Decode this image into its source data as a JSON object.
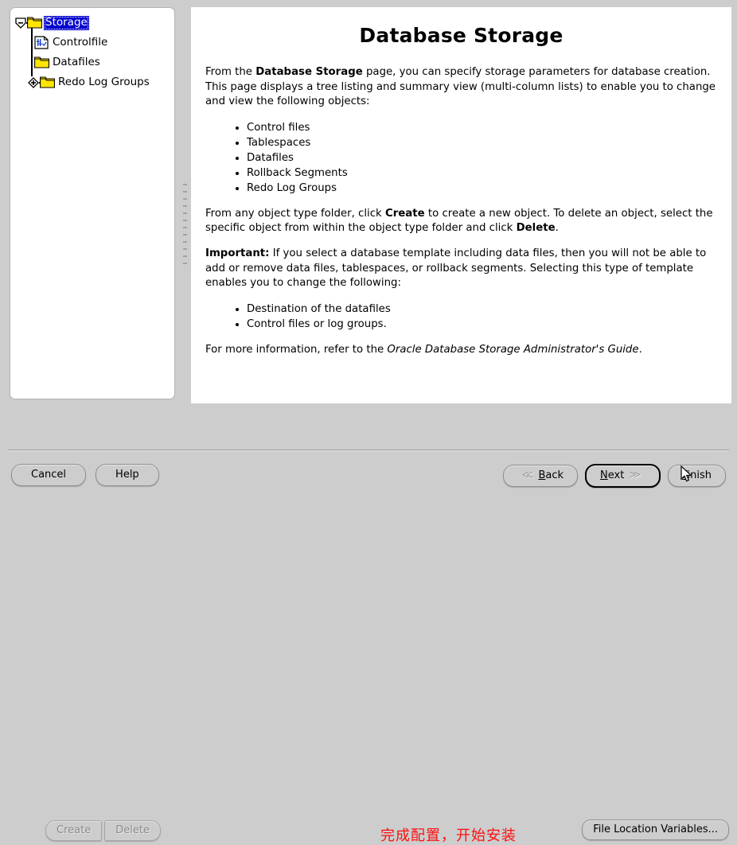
{
  "tree": {
    "nodes": [
      {
        "label": "Storage",
        "icon": "folder-icon",
        "state": "expanded",
        "selected": true
      },
      {
        "label": "Controlfile",
        "icon": "controlfile-document-icon",
        "state": "leaf",
        "selected": false
      },
      {
        "label": "Datafiles",
        "icon": "folder-icon",
        "state": "leaf",
        "selected": false
      },
      {
        "label": "Redo Log Groups",
        "icon": "folder-icon",
        "state": "collapsed",
        "selected": false
      }
    ]
  },
  "content": {
    "title": "Database Storage",
    "para1_pre": "From the ",
    "para1_bold": "Database Storage",
    "para1_post": " page, you can specify storage parameters for database creation. This page displays a tree listing and summary view (multi-column lists) to enable you to change and view the following objects:",
    "list1": [
      "Control files",
      "Tablespaces",
      "Datafiles",
      "Rollback Segments",
      "Redo Log Groups"
    ],
    "para2_pre": "From any object type folder, click ",
    "para2_bold1": "Create",
    "para2_mid": " to create a new object. To delete an object, select the specific object from within the object type folder and click ",
    "para2_bold2": "Delete",
    "para2_post": ".",
    "para3_bold": "Important:",
    "para3_post": " If you select a database template including data files, then you will not be able to add or remove data files, tablespaces, or rollback segments. Selecting this type of template enables you to change the following:",
    "list2": [
      "Destination of the datafiles",
      "Control files or log groups."
    ],
    "para4_pre": "For more information, refer to the ",
    "para4_italic": "Oracle Database Storage Administrator's Guide",
    "para4_post": "."
  },
  "toolbar": {
    "create_label": "Create",
    "delete_label": "Delete",
    "file_location_label": "File Location Variables..."
  },
  "annotation": {
    "text": "完成配置，开始安装",
    "color": "#fc0f10"
  },
  "nav": {
    "cancel_label": "Cancel",
    "help_label": "Help",
    "back_mnemonic": "B",
    "back_label": "ack",
    "back_arrow": "≪",
    "next_mnemonic": "N",
    "next_label": "ext",
    "next_arrow": "≫",
    "finish_mnemonic": "F",
    "finish_label": "inish"
  },
  "colors": {
    "window_bg": "#cdcdcd",
    "panel_bg": "#ffffff",
    "selection_bg": "#0000cd",
    "folder_yellow": "#ffe500",
    "annotation_red": "#fc0f10"
  }
}
